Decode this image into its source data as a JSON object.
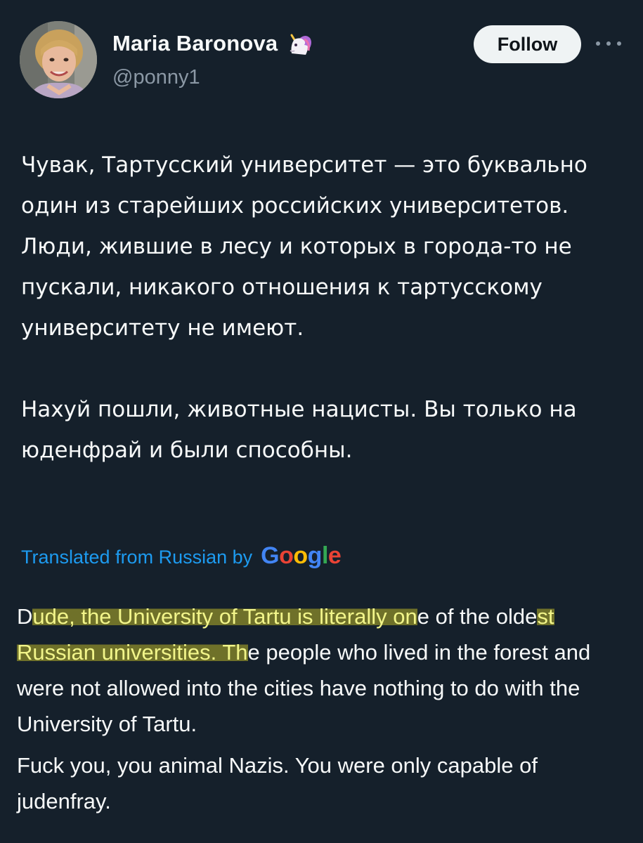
{
  "tweet": {
    "author": {
      "display_name": "Maria Baronova",
      "handle": "@ponny1",
      "badge_icon": "unicorn-emoji-icon"
    },
    "follow_label": "Follow",
    "more_icon": "more-horizontal-icon",
    "original": {
      "paragraph_1": "Чувак, Тартусский университет — это буквально один из старейших российских университетов. Люди, жившие в лесу и которых в города-то не пускали, никакого отношения к тартусскому университету не имеют.",
      "paragraph_2": "Нахуй пошли, животные нацисты. Вы только на юденфрай и были способны."
    },
    "translated_label": "Translated from Russian by",
    "google_logo": {
      "letters": [
        "G",
        "o",
        "o",
        "g",
        "l",
        "e"
      ],
      "colors": [
        "#4285f4",
        "#ea4335",
        "#fbbc05",
        "#4285f4",
        "#34a853",
        "#ea4335"
      ]
    },
    "translation": {
      "p1_part1": "D",
      "p1_highlight1": "ude, the University of Tartu is literally on",
      "p1_part2": "e of the olde",
      "p1_highlight2": "st Russian universities. Th",
      "p1_part3": "e people who lived in the forest and were not allowed into the cities have nothing to do with the University of Tartu.",
      "paragraph_2": "Fuck you, you animal Nazis. You were only capable of judenfray."
    }
  },
  "colors": {
    "background": "#15202b",
    "text": "#f7f9f9",
    "secondary_text": "#8b98a5",
    "link": "#1d9bf0",
    "highlight": "#b9b428"
  }
}
